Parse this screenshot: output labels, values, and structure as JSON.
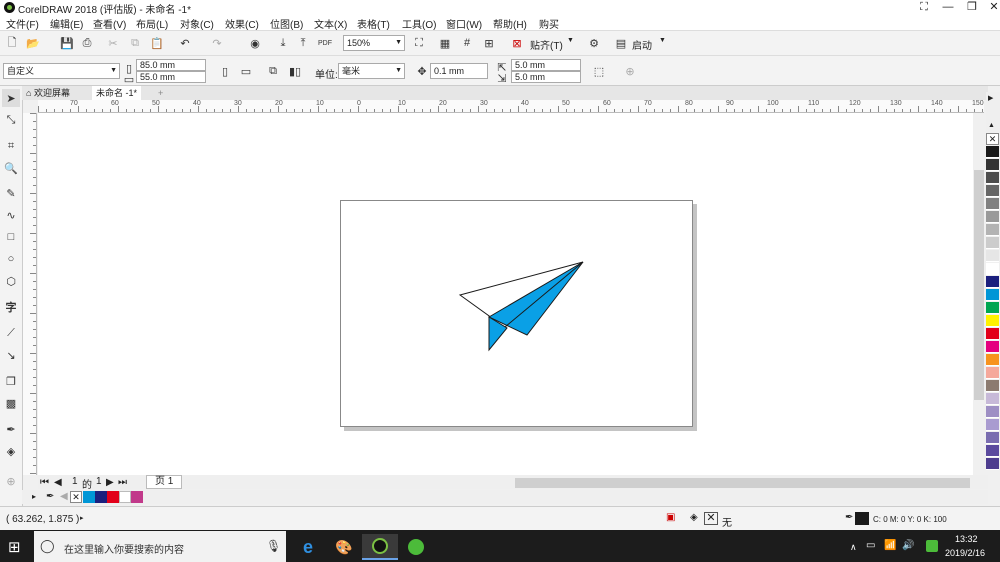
{
  "window": {
    "title": "CorelDRAW 2018 (评估版) - 未命名 -1*"
  },
  "menu": [
    "文件(F)",
    "编辑(E)",
    "查看(V)",
    "布局(L)",
    "对象(C)",
    "效果(C)",
    "位图(B)",
    "文本(X)",
    "表格(T)",
    "工具(O)",
    "窗口(W)",
    "帮助(H)",
    "购买"
  ],
  "toolbar1": {
    "zoom": "150%",
    "snap_label": "贴齐(T)",
    "launch_label": "启动"
  },
  "toolbar2": {
    "page_size": "自定义",
    "width": "85.0 mm",
    "height": "55.0 mm",
    "units_label": "单位:",
    "units": "毫米",
    "nudge": "0.1 mm",
    "dup_x": "5.0 mm",
    "dup_y": "5.0 mm"
  },
  "tabs": {
    "welcome": "欢迎屏幕",
    "doc": "未命名 -1*"
  },
  "ruler": {
    "h_ticks": [
      "70",
      "60",
      "50",
      "40",
      "30",
      "20",
      "10",
      "0",
      "10",
      "20",
      "30",
      "40",
      "50",
      "60",
      "70",
      "80",
      "90",
      "100",
      "110",
      "120",
      "130",
      "140",
      "150"
    ]
  },
  "pagebar": {
    "current": "1",
    "of": "的",
    "total": "1",
    "page_tab": "页 1"
  },
  "palette": {
    "colors": [
      "#ffffff",
      "#1a1a1a",
      "#333333",
      "#4d4d4d",
      "#666666",
      "#808080",
      "#999999",
      "#b3b3b3",
      "#cccccc",
      "#e6e6e6",
      "#ffffff",
      "#1b1f7e",
      "#0096d6",
      "#00a651",
      "#fff200",
      "#e2001a",
      "#e4007f",
      "#f7931e",
      "#f5a89b",
      "#8c7b70",
      "#c7b9d8",
      "#9e8fc4",
      "#a99bd0",
      "#7a6db0",
      "#5b4a9e",
      "#4e3d8f"
    ]
  },
  "doc_palette": {
    "colors": [
      "#0096d6",
      "#1b1f7e",
      "#e2001a",
      "#ffffff",
      "#c1398a"
    ]
  },
  "status": {
    "coords": "( 63.262, 1.875 )",
    "fill_label": "无",
    "color_readout": "C: 0 M: 0 Y: 0 K: 100"
  },
  "taskbar": {
    "search_placeholder": "在这里输入你要搜索的内容",
    "time": "13:32",
    "date": "2019/2/16"
  },
  "colors": {
    "plane_blue": "#0aa0e6",
    "plane_dark": "#1a1a1a"
  }
}
